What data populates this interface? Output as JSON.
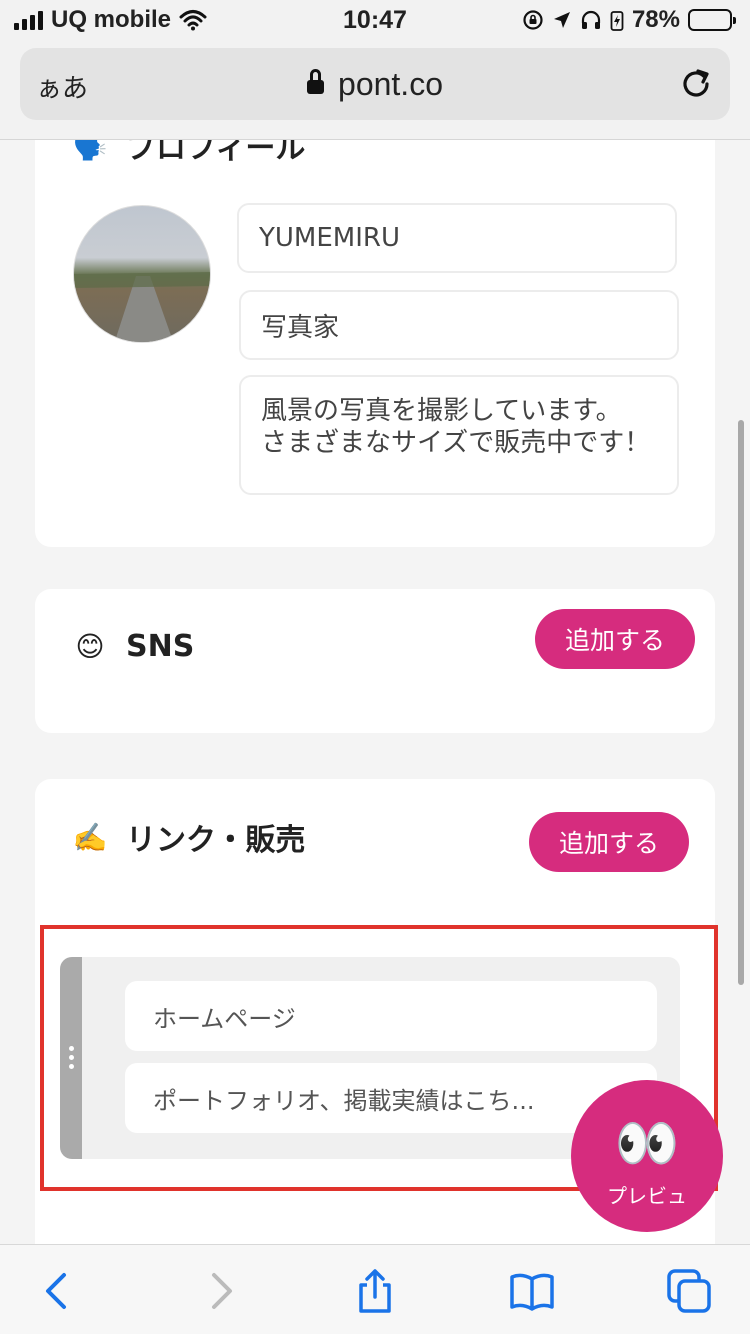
{
  "status_bar": {
    "carrier": "UQ mobile",
    "time": "10:47",
    "battery_percent": "78%",
    "battery_level": 0.78
  },
  "browser": {
    "text_size_button": "ぁあ",
    "host": "pont.co"
  },
  "profile": {
    "icon": "speaking-head-icon",
    "title": "プロフィール",
    "name_value": "YUMEMIRU",
    "job_value": "写真家",
    "bio_value": "風景の写真を撮影しています。\nさまざまなサイズで販売中です！"
  },
  "sns": {
    "icon": "smiling-face-icon",
    "title": "SNS",
    "add_label": "追加する"
  },
  "links": {
    "icon": "writing-hand-icon",
    "title": "リンク・販売",
    "add_label": "追加する",
    "items": [
      {
        "label": "ホームページ"
      },
      {
        "label": "ポートフォリオ、掲載実績はこち..."
      }
    ]
  },
  "preview": {
    "icon": "eyes-icon",
    "label": "プレビュ"
  },
  "colors": {
    "accent": "#d62c7e",
    "highlight": "#e0332c",
    "ios_blue": "#1a73e8"
  }
}
